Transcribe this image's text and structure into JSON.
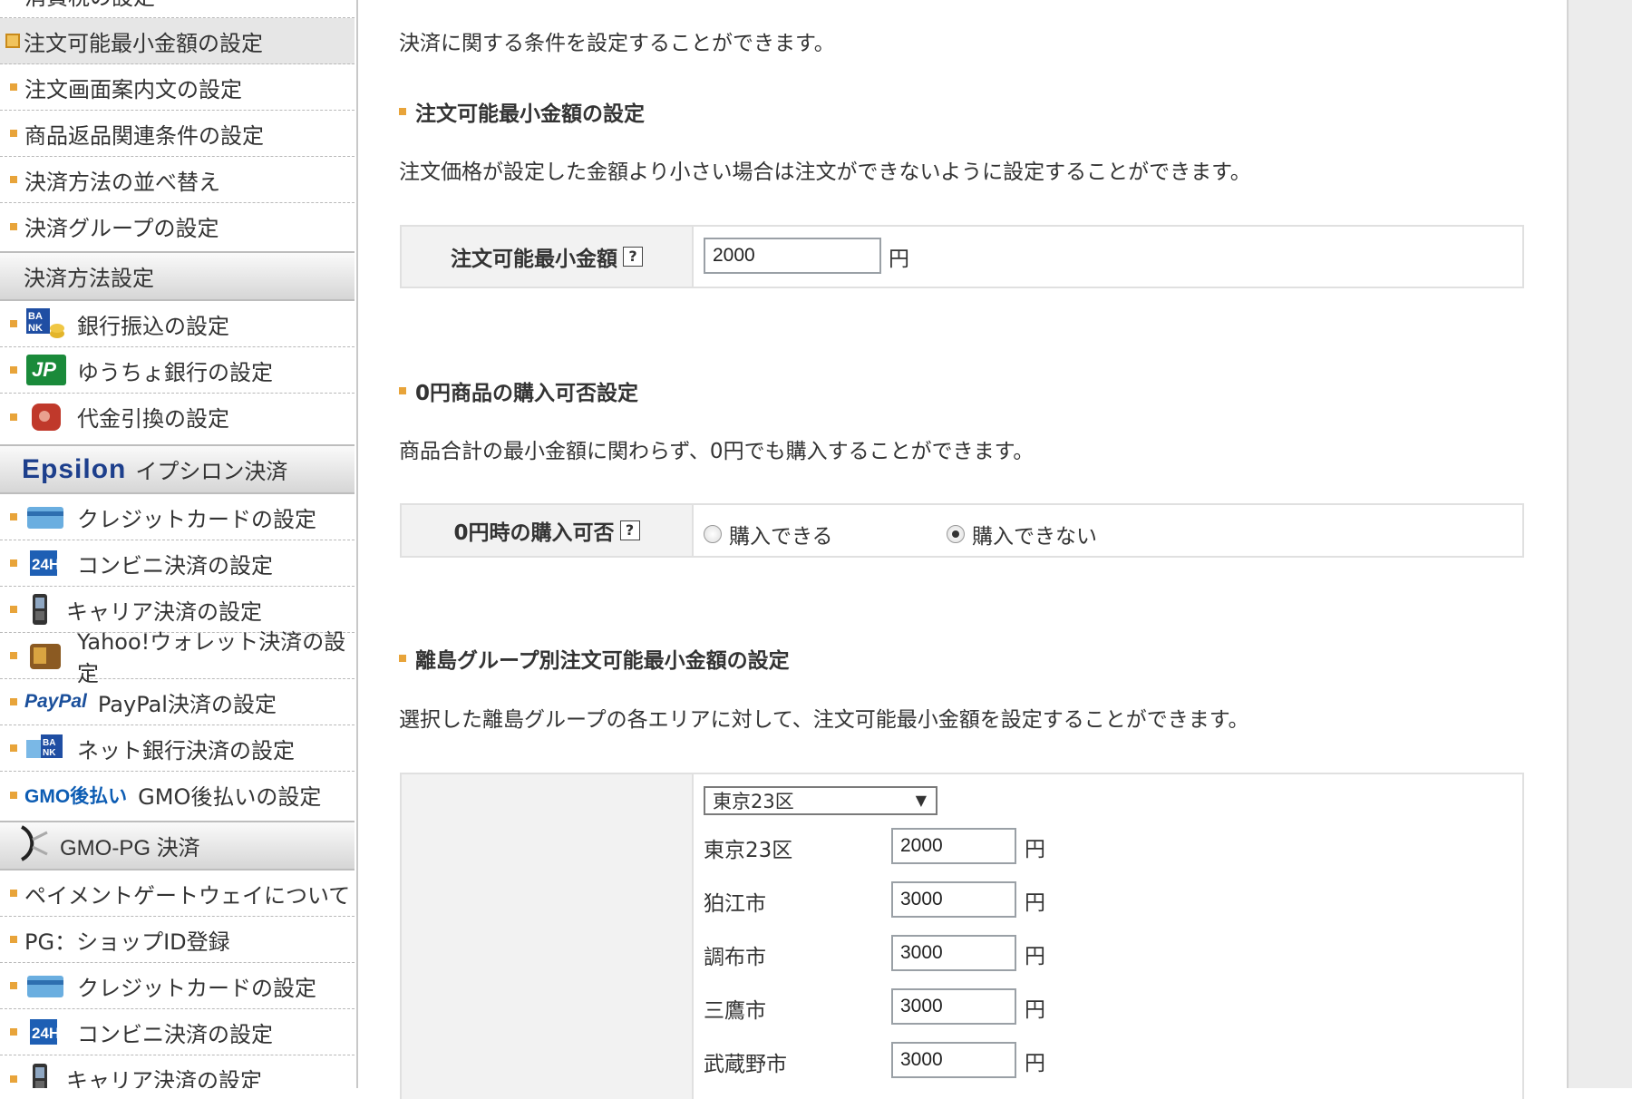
{
  "sidebar": {
    "items_top": [
      {
        "label": "消費税の設定"
      },
      {
        "label": "注文可能最小金額の設定",
        "active": true
      },
      {
        "label": "注文画面案内文の設定"
      },
      {
        "label": "商品返品関連条件の設定"
      },
      {
        "label": "決済方法の並べ替え"
      },
      {
        "label": "決済グループの設定"
      }
    ],
    "section_payment": {
      "title": "決済方法設定"
    },
    "items_payment": [
      {
        "label": "銀行振込の設定",
        "icon": "bank-icon"
      },
      {
        "label": "ゆうちょ銀行の設定",
        "icon": "jp-bank-icon"
      },
      {
        "label": "代金引換の設定",
        "icon": "wallet-icon"
      }
    ],
    "section_epsilon": {
      "logo": "Epsilon",
      "title": "イプシロン決済"
    },
    "items_epsilon": [
      {
        "label": "クレジットカードの設定",
        "icon": "credit-card-icon"
      },
      {
        "label": "コンビニ決済の設定",
        "icon": "24h-icon",
        "icon_text": "24H"
      },
      {
        "label": "キャリア決済の設定",
        "icon": "mobile-phone-icon"
      },
      {
        "label": "Yahoo!ウォレット決済の設定",
        "icon": "yahoo-wallet-icon"
      },
      {
        "label": "PayPal決済の設定",
        "logo": "PayPal"
      },
      {
        "label": "ネット銀行決済の設定",
        "icon": "net-bank-icon"
      },
      {
        "label": "GMO後払いの設定",
        "logo": "GMO後払い"
      }
    ],
    "section_gmo": {
      "title": "GMO-PG 決済"
    },
    "items_gmo": [
      {
        "label": "ペイメントゲートウェイについて"
      },
      {
        "label": "PG：ショップID登録"
      },
      {
        "label": "クレジットカードの設定",
        "icon": "credit-card-icon"
      },
      {
        "label": "コンビニ決済の設定",
        "icon": "24h-icon",
        "icon_text": "24H"
      },
      {
        "label": "キャリア決済の設定",
        "icon": "mobile-phone-icon"
      }
    ]
  },
  "main": {
    "intro": "決済に関する条件を設定することができます。",
    "min_amount": {
      "title": "注文可能最小金額の設定",
      "desc": "注文価格が設定した金額より小さい場合は注文ができないように設定することができます。",
      "label": "注文可能最小金額",
      "help": "?",
      "value": "2000",
      "unit": "円"
    },
    "zero_yen": {
      "title": "0円商品の購入可否設定",
      "desc": "商品合計の最小金額に関わらず、0円でも購入することができます。",
      "label": "0円時の購入可否",
      "help": "?",
      "options": [
        "購入できる",
        "購入できない"
      ],
      "selected": "購入できない"
    },
    "island": {
      "title": "離島グループ別注文可能最小金額の設定",
      "desc": "選択した離島グループの各エリアに対して、注文可能最小金額を設定することができます。",
      "group_select": "東京23区",
      "unit": "円",
      "areas": [
        {
          "name": "東京23区",
          "value": "2000"
        },
        {
          "name": "狛江市",
          "value": "3000"
        },
        {
          "name": "調布市",
          "value": "3000"
        },
        {
          "name": "三鷹市",
          "value": "3000"
        },
        {
          "name": "武蔵野市",
          "value": "3000"
        }
      ]
    }
  }
}
